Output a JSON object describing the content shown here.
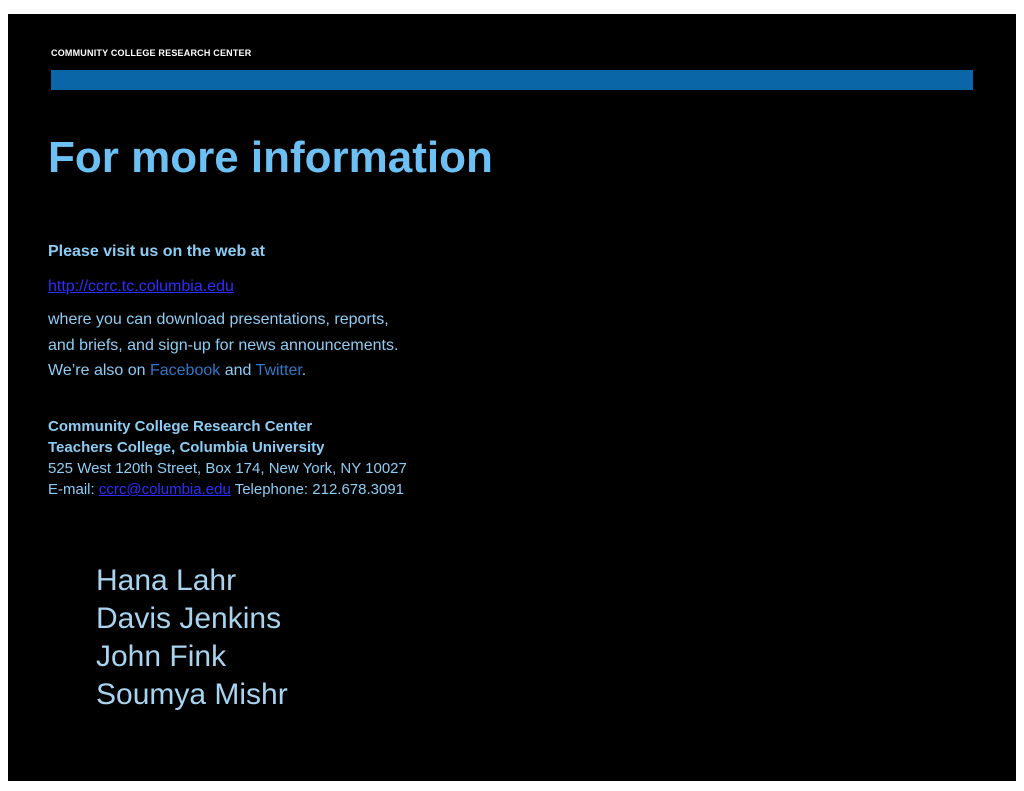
{
  "header": {
    "org_name": "COMMUNITY COLLEGE RESEARCH CENTER",
    "bar_color": "#0b66a8"
  },
  "title": "For more information",
  "visit": {
    "heading": "Please visit us on the web at",
    "url": "http://ccrc.tc.columbia.edu",
    "line1": "where you can download presentations, reports,",
    "line2": "and briefs, and sign-up for news announcements.",
    "line3_prefix": "We’re also on ",
    "facebook": "Facebook",
    "and": " and ",
    "twitter": "Twitter",
    "line3_suffix": "."
  },
  "contact": {
    "org": "Community College Research Center",
    "college": "Teachers College, Columbia University",
    "address": "525 West 120th Street, Box 174, New York, NY 10027",
    "email_label": "E-mail: ",
    "email": "ccrc@columbia.edu",
    "telephone": " Telephone: 212.678.3091"
  },
  "authors": [
    "Hana Lahr",
    "Davis Jenkins",
    "John Fink",
    "Soumya Mishr"
  ]
}
